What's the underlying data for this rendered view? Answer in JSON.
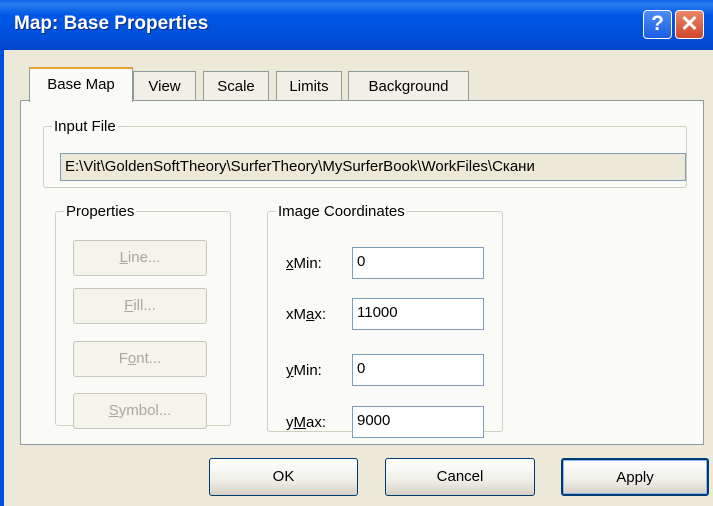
{
  "window": {
    "title": "Map: Base Properties",
    "help_glyph": "?",
    "close_glyph": "✕",
    "icons": [
      "help-icon",
      "close-icon"
    ]
  },
  "tabs": [
    {
      "label": "Base Map",
      "active": true
    },
    {
      "label": "View",
      "active": false
    },
    {
      "label": "Scale",
      "active": false
    },
    {
      "label": "Limits",
      "active": false
    },
    {
      "label": "Background",
      "active": false
    }
  ],
  "input_file": {
    "legend": "Input File",
    "path": "E:\\Vit\\GoldenSoftTheory\\SurferTheory\\MySurferBook\\WorkFiles\\Скани"
  },
  "properties": {
    "legend": "Properties",
    "buttons": {
      "line": {
        "u": "L",
        "rest": "ine..."
      },
      "fill": {
        "u": "F",
        "rest": "ill..."
      },
      "font": {
        "pre": "F",
        "u": "o",
        "rest": "nt..."
      },
      "symbol": {
        "u": "S",
        "rest": "ymbol..."
      }
    }
  },
  "image_coordinates": {
    "legend": "Image Coordinates",
    "xmin": {
      "pre": "",
      "u": "x",
      "rest": "Min:",
      "value": "0"
    },
    "xmax": {
      "pre": "xM",
      "u": "a",
      "rest": "x:",
      "value": "11000"
    },
    "ymin": {
      "pre": "",
      "u": "y",
      "rest": "Min:",
      "value": "0"
    },
    "ymax": {
      "pre": "y",
      "u": "M",
      "rest": "ax:",
      "value": "9000"
    }
  },
  "footer": {
    "ok": "OK",
    "cancel": "Cancel",
    "apply": "Apply"
  },
  "colors": {
    "titlebar": "#0050DC",
    "dialog_bg": "#ECE9D8",
    "tab_highlight": "#E6A234"
  }
}
